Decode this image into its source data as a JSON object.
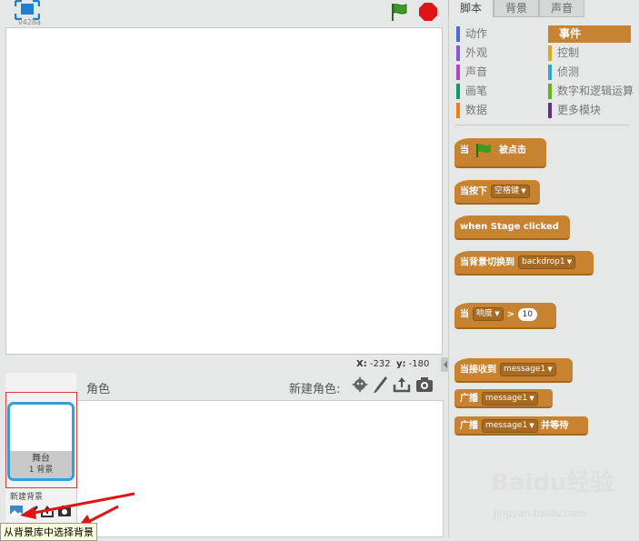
{
  "player": {
    "version": "v428a",
    "coords": {
      "x_label": "X:",
      "x_value": "-232",
      "y_label": "y:",
      "y_value": "-180"
    }
  },
  "sprites_panel": {
    "title": "角色",
    "new_sprite_label": "新建角色:",
    "stage_thumb": {
      "name": "舞台",
      "count": "1 背景"
    },
    "new_backdrop_label": "新建背景",
    "tooltip": "从背景库中选择背景"
  },
  "tabs": [
    {
      "label": "脚本"
    },
    {
      "label": "背景"
    },
    {
      "label": "声音"
    }
  ],
  "categories": {
    "left": [
      {
        "label": "动作",
        "color": "#4a6cd4"
      },
      {
        "label": "外观",
        "color": "#8a55d7"
      },
      {
        "label": "声音",
        "color": "#bb42c3"
      },
      {
        "label": "画笔",
        "color": "#0e9a6c"
      },
      {
        "label": "数据",
        "color": "#ee7d16"
      }
    ],
    "right": [
      {
        "label": "事件",
        "color": "#c88330"
      },
      {
        "label": "控制",
        "color": "#e1a91a"
      },
      {
        "label": "侦测",
        "color": "#2ca5e2"
      },
      {
        "label": "数字和逻辑运算",
        "color": "#5cb712"
      },
      {
        "label": "更多模块",
        "color": "#632d99"
      }
    ]
  },
  "blocks": {
    "flag_prefix": "当",
    "flag_suffix": "被点击",
    "key_prefix": "当按下",
    "key_value": "空格键",
    "stage_clicked": "when Stage clicked",
    "backdrop_prefix": "当背景切换到",
    "backdrop_value": "backdrop1",
    "sensor_prefix": "当",
    "sensor_value": "响度",
    "sensor_op": ">",
    "sensor_num": "10",
    "receive_prefix": "当接收到",
    "receive_value": "message1",
    "broadcast_prefix": "广播",
    "broadcast_value": "message1",
    "broadcast_wait_prefix": "广播",
    "broadcast_wait_value": "message1",
    "broadcast_wait_suffix": "并等待"
  },
  "watermark": {
    "brand": "Baidu经验",
    "url": "jingyan.baidu.com"
  }
}
